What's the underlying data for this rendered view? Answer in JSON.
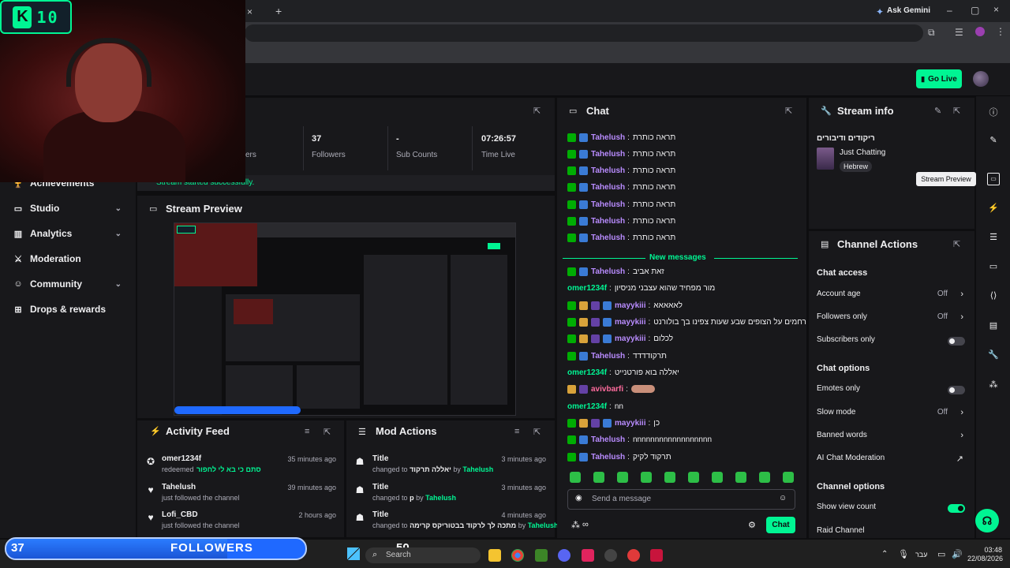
{
  "browser": {
    "ask_label": "Ask Gemini",
    "new_tab_icon": "plus-icon"
  },
  "overlay": {
    "logo_letter": "K",
    "logo_number": "10"
  },
  "topbar": {
    "go_live_label": "Go Live"
  },
  "sidebar": {
    "items": [
      {
        "label": "Achievements",
        "icon": "trophy-icon"
      },
      {
        "label": "Studio",
        "icon": "monitor-icon",
        "chevron": true
      },
      {
        "label": "Analytics",
        "icon": "chart-icon",
        "chevron": true
      },
      {
        "label": "Moderation",
        "icon": "sword-icon"
      },
      {
        "label": "Community",
        "icon": "people-icon",
        "chevron": true
      },
      {
        "label": "Drops & rewards",
        "icon": "gift-icon"
      }
    ]
  },
  "stats": {
    "items": [
      {
        "value": "37",
        "label": "Followers"
      },
      {
        "value": "-",
        "label": "Sub Counts"
      },
      {
        "value": "07:26:57",
        "label": "Time Live"
      }
    ],
    "partial_label": "ers",
    "started_msg": "Stream started successfully."
  },
  "preview": {
    "title": "Stream Preview"
  },
  "activity": {
    "title": "Activity Feed",
    "items": [
      {
        "name": "omer1234f",
        "sub": "redeemed",
        "sub2": "סתם כי בא לי לחפור",
        "time": "35 minutes ago"
      },
      {
        "name": "Tahelush",
        "sub": "just followed the channel",
        "time": "39 minutes ago"
      },
      {
        "name": "Lofi_CBD",
        "sub": "just followed the channel",
        "time": "2 hours ago"
      }
    ]
  },
  "mod_actions": {
    "title": "Mod Actions",
    "items": [
      {
        "name": "Title",
        "prefix": "changed to",
        "value": "יאללה תרקוד",
        "by": "by",
        "user": "Tahelush",
        "time": "3 minutes ago"
      },
      {
        "name": "Title",
        "prefix": "changed to",
        "value": "p",
        "by": "by",
        "user": "Tahelush",
        "time": "3 minutes ago"
      },
      {
        "name": "Title",
        "prefix": "changed to",
        "value": "מתכה לך לרקוד בבטוריקס קרימה",
        "by": "by",
        "user": "Tahelush",
        "time": "4 minutes ago"
      }
    ]
  },
  "chat": {
    "title": "Chat",
    "new_messages": "New messages",
    "placeholder": "Send a message",
    "send_label": "Chat",
    "messages": [
      {
        "user": "Tahelush",
        "color": "#b98cff",
        "badges": [
          "mod",
          "vip"
        ],
        "text": "תראה כותרת"
      },
      {
        "user": "Tahelush",
        "color": "#b98cff",
        "badges": [
          "mod",
          "vip"
        ],
        "text": "תראה כותרת"
      },
      {
        "user": "Tahelush",
        "color": "#b98cff",
        "badges": [
          "mod",
          "vip"
        ],
        "text": "תראה כותרת"
      },
      {
        "user": "Tahelush",
        "color": "#b98cff",
        "badges": [
          "mod",
          "vip"
        ],
        "text": "תראה כותרת"
      },
      {
        "user": "Tahelush",
        "color": "#b98cff",
        "badges": [
          "mod",
          "vip"
        ],
        "text": "תראה כותרת"
      },
      {
        "user": "Tahelush",
        "color": "#b98cff",
        "badges": [
          "mod",
          "vip"
        ],
        "text": "תראה כותרת"
      },
      {
        "user": "Tahelush",
        "color": "#b98cff",
        "badges": [
          "mod",
          "vip"
        ],
        "text": "תראה כותרת"
      },
      {
        "user": "Tahelush",
        "color": "#b98cff",
        "badges": [
          "mod",
          "vip"
        ],
        "text": "זאת אביב"
      },
      {
        "user": "omer1234f",
        "color": "#00f593",
        "badges": [],
        "text": "מור מפחיד שהוא עצבני מניסיון"
      },
      {
        "user": "mayykiii",
        "color": "#b98cff",
        "badges": [
          "mod",
          "sub",
          "gift",
          "vip"
        ],
        "text": "לאאאאא"
      },
      {
        "user": "mayykiii",
        "color": "#b98cff",
        "badges": [
          "mod",
          "sub",
          "gift",
          "vip"
        ],
        "text": "רחמים על הצופים שבע שעות צפינו בך בולורנט"
      },
      {
        "user": "mayykiii",
        "color": "#b98cff",
        "badges": [
          "mod",
          "sub",
          "gift",
          "vip"
        ],
        "text": "לכלום"
      },
      {
        "user": "Tahelush",
        "color": "#b98cff",
        "badges": [
          "mod",
          "vip"
        ],
        "text": "תרקודדדד"
      },
      {
        "user": "omer1234f",
        "color": "#00f593",
        "badges": [],
        "text": "יאללה בוא פורטנייט"
      },
      {
        "user": "avivbarfi",
        "color": "#ff6b9d",
        "badges": [
          "sub",
          "gift"
        ],
        "text": ""
      },
      {
        "user": "omer1234f",
        "color": "#00f593",
        "badges": [],
        "text": "nn"
      },
      {
        "user": "mayykiii",
        "color": "#b98cff",
        "badges": [
          "mod",
          "sub",
          "gift",
          "vip"
        ],
        "text": "כן"
      },
      {
        "user": "Tahelush",
        "color": "#b98cff",
        "badges": [
          "mod",
          "vip"
        ],
        "text": "nnnnnnnnnnnnnnnnnn"
      },
      {
        "user": "Tahelush",
        "color": "#b98cff",
        "badges": [
          "mod",
          "vip"
        ],
        "text": "תרקוד לקיק"
      }
    ]
  },
  "stream_info": {
    "title": "Stream info",
    "stream_title": "ריקודים ודיבורים",
    "category": "Just Chatting",
    "tag": "Hebrew"
  },
  "channel_actions": {
    "title": "Channel Actions",
    "chat_access": "Chat access",
    "account_age": {
      "label": "Account age",
      "value": "Off"
    },
    "followers_only": {
      "label": "Followers only",
      "value": "Off"
    },
    "subscribers_only": {
      "label": "Subscribers only",
      "on": false
    },
    "chat_options": "Chat options",
    "emotes_only": {
      "label": "Emotes only",
      "on": false
    },
    "slow_mode": {
      "label": "Slow mode",
      "value": "Off"
    },
    "banned_words": {
      "label": "Banned words"
    },
    "ai_mod": {
      "label": "AI Chat Moderation"
    },
    "channel_options": "Channel options",
    "show_view_count": {
      "label": "Show view count",
      "on": true
    },
    "raid_channel": {
      "label": "Raid Channel"
    }
  },
  "rail": {
    "tooltip": "Stream Preview"
  },
  "followers_goal": {
    "current": "37",
    "label": "FOLLOWERS",
    "target": "50",
    "progress": 0.74
  },
  "taskbar": {
    "search_label": "Search",
    "lang": "עבר",
    "time": "03:48",
    "date": "22/08/2026"
  },
  "colors": {
    "accent": "#00f593",
    "bg": "#0e0e10",
    "panel": "#18181b"
  }
}
